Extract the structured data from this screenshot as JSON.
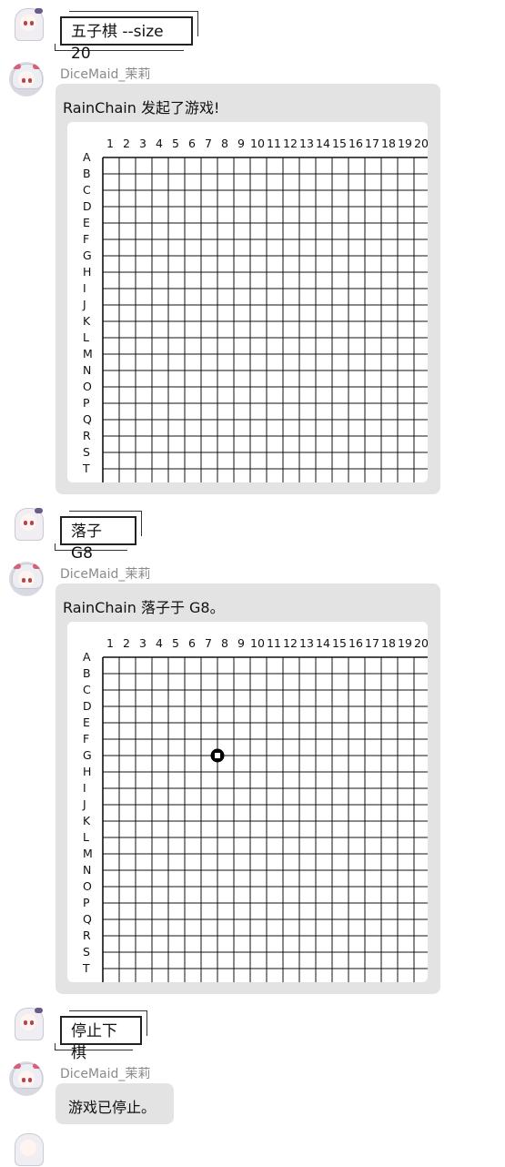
{
  "messages": [
    {
      "type": "user",
      "command": "五子棋 --size 20"
    },
    {
      "type": "bot",
      "sender": "DiceMaid_茉莉",
      "text": "RainChain 发起了游戏!",
      "board": {
        "size": 20,
        "stones": []
      }
    },
    {
      "type": "user",
      "command": "落子 G8"
    },
    {
      "type": "bot",
      "sender": "DiceMaid_茉莉",
      "text": "RainChain 落子于 G8。",
      "board": {
        "size": 20,
        "stones": [
          {
            "row": "G",
            "col": 8,
            "color": "black",
            "last": true
          }
        ]
      }
    },
    {
      "type": "user",
      "command": "停止下棋"
    },
    {
      "type": "bot",
      "sender": "DiceMaid_茉莉",
      "text": "游戏已停止。"
    }
  ],
  "board_labels": {
    "cols": [
      "1",
      "2",
      "3",
      "4",
      "5",
      "6",
      "7",
      "8",
      "9",
      "10",
      "11",
      "12",
      "13",
      "14",
      "15",
      "16",
      "17",
      "18",
      "19",
      "20"
    ],
    "rows": [
      "A",
      "B",
      "C",
      "D",
      "E",
      "F",
      "G",
      "H",
      "I",
      "J",
      "K",
      "L",
      "M",
      "N",
      "O",
      "P",
      "Q",
      "R",
      "S",
      "T"
    ]
  }
}
